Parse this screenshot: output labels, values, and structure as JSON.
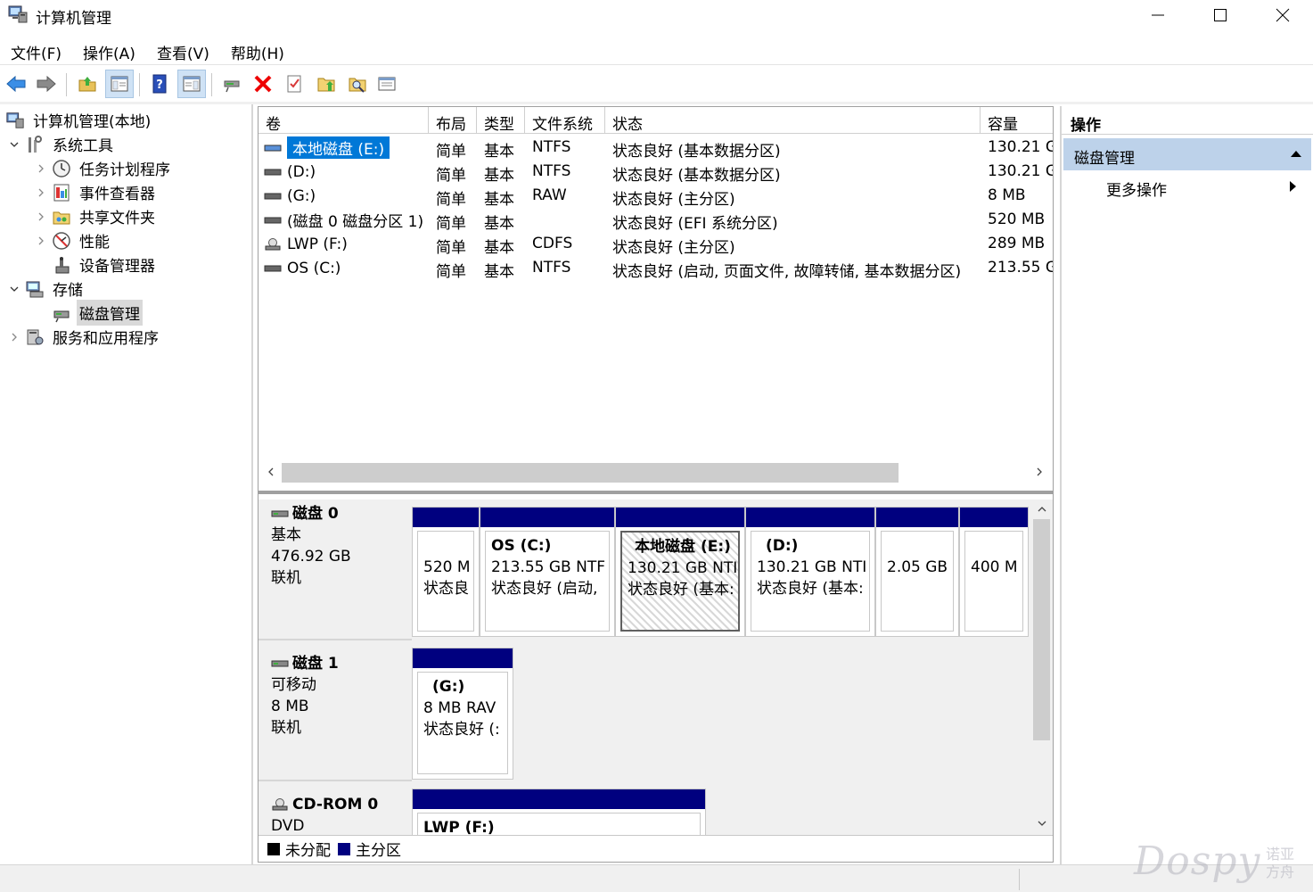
{
  "window": {
    "title": "计算机管理",
    "icon": "computer-management-icon"
  },
  "menu": [
    "文件(F)",
    "操作(A)",
    "查看(V)",
    "帮助(H)"
  ],
  "toolbar": {
    "buttons": [
      "back-icon",
      "forward-icon",
      "up-folder-icon",
      "show-hide-tree-icon",
      "help-icon",
      "show-hide-action-pane-icon",
      "connect-drive-icon",
      "delete-icon",
      "properties-icon",
      "open-folder-icon",
      "find-icon",
      "more-icon"
    ]
  },
  "tree": {
    "root": "计算机管理(本地)",
    "system_tools": "系统工具",
    "task_scheduler": "任务计划程序",
    "event_viewer": "事件查看器",
    "shared_folders": "共享文件夹",
    "performance": "性能",
    "device_manager": "设备管理器",
    "storage": "存储",
    "disk_management": "磁盘管理",
    "services_apps": "服务和应用程序"
  },
  "volumes": {
    "headers": [
      "卷",
      "布局",
      "类型",
      "文件系统",
      "状态",
      "容量"
    ],
    "rows": [
      {
        "name": "本地磁盘 (E:)",
        "layout": "简单",
        "type": "基本",
        "fs": "NTFS",
        "status": "状态良好 (基本数据分区)",
        "capacity": "130.21 G"
      },
      {
        "name": "(D:)",
        "layout": "简单",
        "type": "基本",
        "fs": "NTFS",
        "status": "状态良好 (基本数据分区)",
        "capacity": "130.21 G"
      },
      {
        "name": "(G:)",
        "layout": "简单",
        "type": "基本",
        "fs": "RAW",
        "status": "状态良好 (主分区)",
        "capacity": "8 MB"
      },
      {
        "name": "(磁盘 0 磁盘分区 1)",
        "layout": "简单",
        "type": "基本",
        "fs": "",
        "status": "状态良好 (EFI 系统分区)",
        "capacity": "520 MB"
      },
      {
        "name": "LWP (F:)",
        "layout": "简单",
        "type": "基本",
        "fs": "CDFS",
        "status": "状态良好 (主分区)",
        "capacity": "289 MB"
      },
      {
        "name": "OS (C:)",
        "layout": "简单",
        "type": "基本",
        "fs": "NTFS",
        "status": "状态良好 (启动, 页面文件, 故障转储, 基本数据分区)",
        "capacity": "213.55 G"
      }
    ]
  },
  "disks": {
    "disk0": {
      "name": "磁盘 0",
      "type": "基本",
      "size": "476.92 GB",
      "state": "联机"
    },
    "disk1": {
      "name": "磁盘 1",
      "type": "可移动",
      "size": "8 MB",
      "state": "联机"
    },
    "cdrom0": {
      "name": "CD-ROM 0",
      "type": "DVD"
    }
  },
  "partitions": {
    "d0p1": {
      "l1": "520 M",
      "l2": "状态良"
    },
    "d0p2": {
      "name": "OS  (C:)",
      "l1": "213.55 GB NTF",
      "l2": "状态良好 (启动,"
    },
    "d0p3": {
      "name": "本地磁盘  (E:)",
      "l1": "130.21 GB NTI",
      "l2": "状态良好 (基本:"
    },
    "d0p4": {
      "name": "(D:)",
      "l1": "130.21 GB NTI",
      "l2": "状态良好 (基本:"
    },
    "d0p5": {
      "l1": "2.05 GB"
    },
    "d0p6": {
      "l1": "400 M"
    },
    "d1p1": {
      "name": "(G:)",
      "l1": "8 MB RAV",
      "l2": "状态良好 (:"
    },
    "cd0p1": {
      "name": "LWP  (F:)"
    }
  },
  "legend": {
    "unallocated": "未分配",
    "primary": "主分区"
  },
  "actions": {
    "header": "操作",
    "section": "磁盘管理",
    "more": "更多操作"
  },
  "watermark": {
    "main": "Dospy",
    "sub1": "诺亚",
    "sub2": "方舟"
  },
  "colors": {
    "primary_partition": "#00007f",
    "selection": "#0078d7",
    "action_section": "#bdd2ea"
  }
}
